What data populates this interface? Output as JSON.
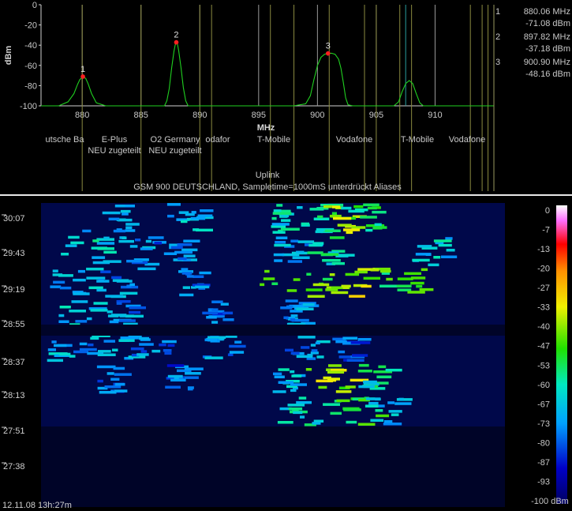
{
  "chart_data": [
    {
      "type": "line",
      "ylabel": "dBm",
      "xlabel": "MHz",
      "ylim": [
        -100,
        0
      ],
      "xlim": [
        876.5,
        915.0
      ],
      "yticks": [
        "0",
        "-20",
        "-40",
        "-60",
        "-80",
        "-100"
      ],
      "xticks": [
        "880",
        "885",
        "890",
        "895",
        "900",
        "905",
        "910"
      ],
      "grid": "off",
      "series": [
        {
          "x": [
            876.5,
            878.0,
            878.8,
            879.3,
            879.6,
            879.8,
            880.06,
            880.3,
            880.5,
            880.8,
            881.2,
            882.0,
            887.0,
            887.2,
            887.4,
            887.6,
            887.8,
            887.9,
            888.0,
            888.1,
            888.2,
            888.4,
            888.6,
            888.8,
            889.0,
            889.5,
            898.0,
            899.0,
            899.4,
            899.7,
            900.0,
            900.3,
            900.6,
            900.9,
            901.2,
            901.5,
            901.8,
            902.0,
            902.2,
            902.4,
            902.6,
            903.0,
            906.5,
            906.9,
            907.2,
            907.5,
            907.8,
            908.1,
            908.4,
            908.7,
            909.0,
            915.0
          ],
          "y": [
            -100,
            -100,
            -96,
            -88,
            -79,
            -74,
            -71.08,
            -73,
            -78,
            -88,
            -97,
            -100,
            -100,
            -95,
            -83,
            -63,
            -46,
            -40,
            -37.18,
            -39,
            -45,
            -62,
            -82,
            -95,
            -100,
            -100,
            -100,
            -98,
            -90,
            -74,
            -60,
            -52,
            -49,
            -48.16,
            -48,
            -49,
            -54,
            -63,
            -77,
            -92,
            -99,
            -100,
            -100,
            -96,
            -86,
            -78,
            -75,
            -78,
            -88,
            -97,
            -100,
            -100
          ]
        }
      ],
      "markers": [
        {
          "label": "1",
          "x": 880.06,
          "y": -71.08
        },
        {
          "label": "2",
          "x": 897.82,
          "y": -37.18
        },
        {
          "label": "3",
          "x": 900.9,
          "y": -48.16
        }
      ],
      "marker_readout": [
        {
          "num": "1",
          "freq": "880.06 MHz",
          "level": "-71.08 dBm"
        },
        {
          "num": "2",
          "freq": "897.82 MHz",
          "level": "-37.18 dBm"
        },
        {
          "num": "3",
          "freq": "900.90 MHz",
          "level": "-48.16 dBm"
        }
      ],
      "channel_edges_mhz": [
        880.0,
        885.0,
        890.0,
        891.0,
        896.0,
        898.0,
        901.0,
        904.0,
        905.0,
        907.0,
        908.0,
        913.0,
        914.0,
        914.5
      ],
      "operators": [
        "utsche Ba",
        "E-Plus",
        "O2 Germany",
        "odafor",
        "T-Mobile",
        "Vodafone",
        "T-Mobile",
        "Vodafone"
      ],
      "assignments": [
        "NEU zugeteilt",
        "NEU zugeteilt"
      ],
      "band_title": "Uplink",
      "caption": "GSM 900 DEUTSCHLAND, Sampletime=1000mS unterdrückt Aliases"
    },
    {
      "type": "heatmap",
      "y_time_labels": [
        "30:07",
        "29:43",
        "29:19",
        "28:55",
        "28:37",
        "28:13",
        "27:51",
        "27:38"
      ],
      "timestamp": "12.11.08 13h:27m",
      "colorbar_labels": [
        "0",
        "-7",
        "-13",
        "-20",
        "-27",
        "-33",
        "-40",
        "-47",
        "-53",
        "-60",
        "-67",
        "-73",
        "-80",
        "-87",
        "-93",
        "-100 dBm"
      ],
      "zlim": [
        -100,
        0
      ],
      "activity_rows": [
        {
          "from": 876.5,
          "to": 914.0,
          "hot": [
            [
              880,
              884,
              -70
            ],
            [
              887,
              890,
              -68
            ],
            [
              896,
              897,
              -64
            ],
            [
              898,
              901,
              -58
            ],
            [
              900,
              903,
              -42
            ],
            [
              902,
              905,
              -55
            ]
          ]
        },
        {
          "from": 876.5,
          "to": 914.0,
          "hot": [
            [
              878,
              882,
              -64
            ],
            [
              883,
              886,
              -72
            ],
            [
              886,
              889,
              -76
            ],
            [
              896,
              899,
              -70
            ],
            [
              899,
              902,
              -60
            ],
            [
              908,
              911,
              -66
            ]
          ]
        },
        {
          "from": 876.5,
          "to": 914.0,
          "hot": [
            [
              877,
              881,
              -68
            ],
            [
              881,
              885,
              -73
            ],
            [
              888,
              890,
              -75
            ],
            [
              895,
              901,
              -45
            ],
            [
              901,
              905,
              -38
            ],
            [
              905,
              909,
              -50
            ]
          ]
        },
        {
          "from": 876.5,
          "to": 914.0,
          "hot": [
            [
              878,
              882,
              -68
            ],
            [
              882,
              884,
              -74
            ],
            [
              890,
              892,
              -76
            ],
            [
              896,
              898,
              -72
            ],
            [
              897,
              899,
              -74
            ]
          ]
        },
        {
          "from": 876.5,
          "to": 914.0,
          "hot": [
            [
              877,
              880,
              -70
            ],
            [
              880,
              884,
              -72
            ],
            [
              884,
              888,
              -76
            ],
            [
              890,
              893,
              -74
            ],
            [
              897,
              900,
              -73
            ],
            [
              901,
              904,
              -80
            ]
          ]
        },
        {
          "from": 876.5,
          "to": 914.0,
          "hot": [
            [
              881,
              883,
              -78
            ],
            [
              887,
              889,
              -78
            ],
            [
              896,
              898,
              -66
            ],
            [
              899,
              903,
              -40
            ],
            [
              903,
              906,
              -60
            ]
          ]
        },
        {
          "from": 876.5,
          "to": 914.0,
          "hot": [
            [
              896,
              901,
              -62
            ],
            [
              901,
              905,
              -50
            ],
            [
              904,
              907,
              -67
            ]
          ]
        }
      ]
    }
  ]
}
